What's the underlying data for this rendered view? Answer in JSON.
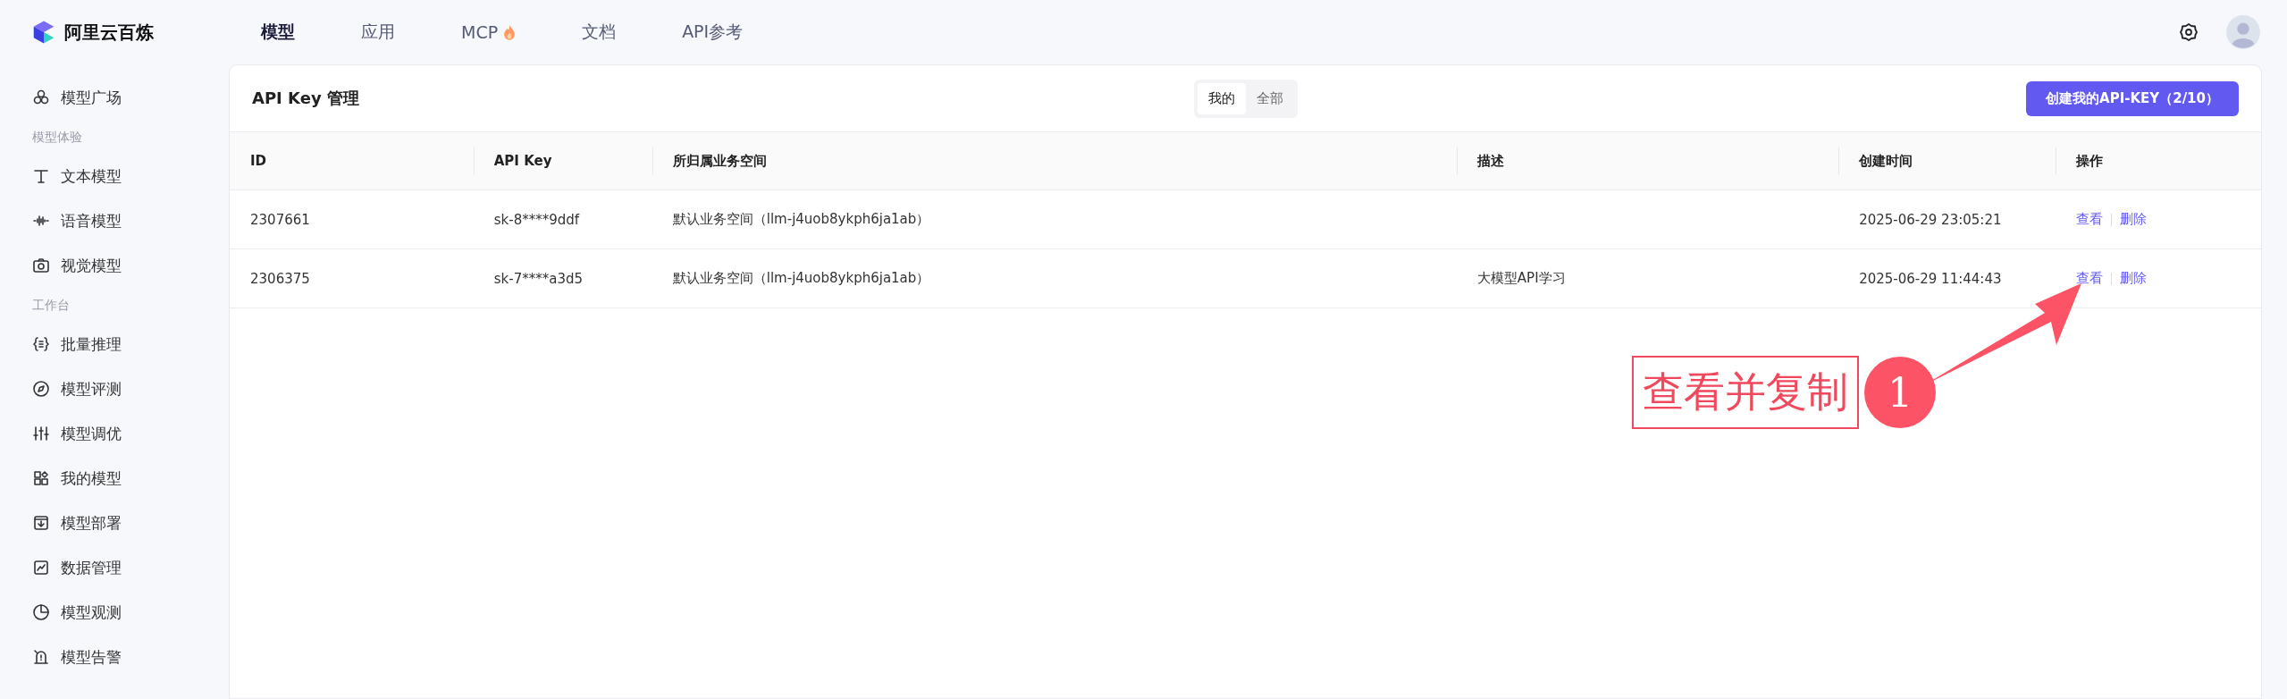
{
  "logo": {
    "text": "阿里云百炼"
  },
  "nav": [
    {
      "label": "模型",
      "selected": true
    },
    {
      "label": "应用",
      "selected": false
    },
    {
      "label": "MCP",
      "selected": false,
      "kind": "hot"
    },
    {
      "label": "文档",
      "selected": false
    },
    {
      "label": "API参考",
      "selected": false
    }
  ],
  "sidebar": {
    "items": [
      {
        "kind": "item",
        "label": "模型广场"
      },
      {
        "kind": "section",
        "label": "模型体验"
      },
      {
        "kind": "item",
        "label": "文本模型"
      },
      {
        "kind": "item",
        "label": "语音模型"
      },
      {
        "kind": "item",
        "label": "视觉模型"
      },
      {
        "kind": "section",
        "label": "工作台"
      },
      {
        "kind": "item",
        "label": "批量推理"
      },
      {
        "kind": "item",
        "label": "模型评测"
      },
      {
        "kind": "item",
        "label": "模型调优"
      },
      {
        "kind": "item",
        "label": "我的模型"
      },
      {
        "kind": "item",
        "label": "模型部署"
      },
      {
        "kind": "item",
        "label": "数据管理"
      },
      {
        "kind": "item",
        "label": "模型观测"
      },
      {
        "kind": "item",
        "label": "模型告警"
      }
    ]
  },
  "panel": {
    "title": "API Key 管理",
    "tabs": [
      {
        "label": "我的",
        "selected": true
      },
      {
        "label": "全部",
        "selected": false
      }
    ],
    "create_button": "创建我的API-KEY（2/10）"
  },
  "table": {
    "columns": [
      "ID",
      "API Key",
      "所归属业务空间",
      "描述",
      "创建时间",
      "操作"
    ],
    "rows": [
      {
        "id": "2307661",
        "key": "sk-8****9ddf",
        "space": "默认业务空间（llm-j4uob8ykph6ja1ab）",
        "desc": "",
        "created": "2025-06-29 23:05:21",
        "actions": [
          "查看",
          "删除"
        ]
      },
      {
        "id": "2306375",
        "key": "sk-7****a3d5",
        "space": "默认业务空间（llm-j4uob8ykph6ja1ab）",
        "desc": "大模型API学习",
        "created": "2025-06-29 11:44:43",
        "actions": [
          "查看",
          "删除"
        ]
      }
    ]
  },
  "annotation": {
    "label": "查看并复制",
    "number": "1"
  }
}
